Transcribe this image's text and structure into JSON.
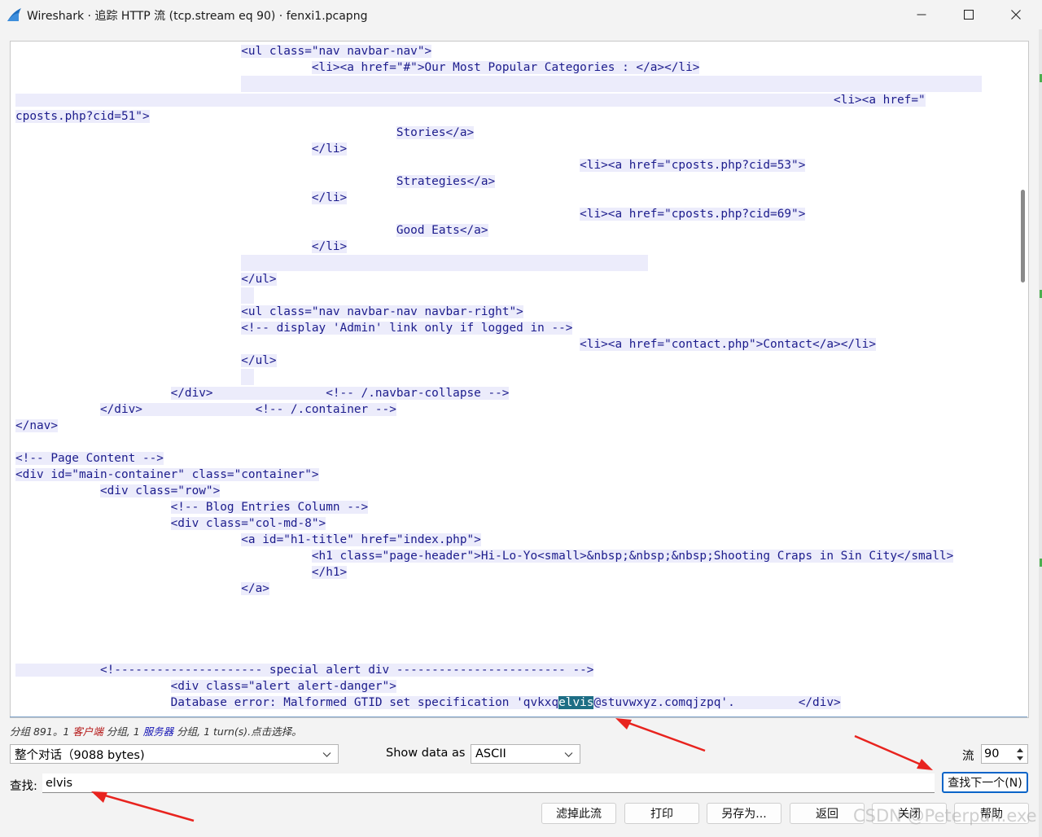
{
  "window": {
    "title": "Wireshark · 追踪 HTTP 流 (tcp.stream eq 90) · fenxi1.pcapng"
  },
  "stream": {
    "lines": [
      {
        "pre": "                                ",
        "text": "<ul class=\"nav navbar-nav\">",
        "kind": "t"
      },
      {
        "pre": "                                          ",
        "text": "<li><a href=\"#\">Our Most Popular Categories : </a></li>",
        "kind": "t"
      },
      {
        "pre": "                                ",
        "text": "",
        "kind": "fill"
      },
      {
        "pre": "",
        "text": "                                                                                                                    <li><a href=\"",
        "kind": "t"
      },
      {
        "pre": "",
        "text": "cposts.php?cid=51\">",
        "kind": "t"
      },
      {
        "pre": "                                                      ",
        "text": "Stories</a>",
        "kind": "t"
      },
      {
        "pre": "                                          ",
        "text": "</li>",
        "kind": "t"
      },
      {
        "pre": "                                                                                ",
        "text": "<li><a href=\"cposts.php?cid=53\">",
        "kind": "t"
      },
      {
        "pre": "                                                      ",
        "text": "Strategies</a>",
        "kind": "t"
      },
      {
        "pre": "                                          ",
        "text": "</li>",
        "kind": "t"
      },
      {
        "pre": "                                                                                ",
        "text": "<li><a href=\"cposts.php?cid=69\">",
        "kind": "t"
      },
      {
        "pre": "                                                      ",
        "text": "Good Eats</a>",
        "kind": "t"
      },
      {
        "pre": "                                          ",
        "text": "</li>",
        "kind": "t"
      },
      {
        "pre": "                                ",
        "text": "",
        "kind": "fillmid"
      },
      {
        "pre": "                                ",
        "text": "</ul>",
        "kind": "t"
      },
      {
        "pre": "                                ",
        "text": "",
        "kind": "fillsmall"
      },
      {
        "pre": "                                ",
        "text": "<ul class=\"nav navbar-nav navbar-right\">",
        "kind": "t"
      },
      {
        "pre": "                                ",
        "text": "<!-- display 'Admin' link only if logged in -->",
        "kind": "t"
      },
      {
        "pre": "                                                                                ",
        "text": "<li><a href=\"contact.php\">Contact</a></li>",
        "kind": "t"
      },
      {
        "pre": "                                ",
        "text": "</ul>",
        "kind": "t"
      },
      {
        "pre": "                                ",
        "text": "",
        "kind": "fillsmall"
      },
      {
        "pre": "                      ",
        "text": "</div>                <!-- /.navbar-collapse -->",
        "kind": "t"
      },
      {
        "pre": "            ",
        "text": "</div>                <!-- /.container -->",
        "kind": "t"
      },
      {
        "pre": "",
        "text": "</nav>",
        "kind": "t"
      },
      {
        "pre": "",
        "text": "",
        "kind": "empty"
      },
      {
        "pre": "",
        "text": "<!-- Page Content -->",
        "kind": "t"
      },
      {
        "pre": "",
        "text": "<div id=\"main-container\" class=\"container\">",
        "kind": "t"
      },
      {
        "pre": "            ",
        "text": "<div class=\"row\">",
        "kind": "t"
      },
      {
        "pre": "                      ",
        "text": "<!-- Blog Entries Column -->",
        "kind": "t"
      },
      {
        "pre": "                      ",
        "text": "<div class=\"col-md-8\">",
        "kind": "t"
      },
      {
        "pre": "                                ",
        "text": "<a id=\"h1-title\" href=\"index.php\">",
        "kind": "t"
      },
      {
        "pre": "                                          ",
        "text": "<h1 class=\"page-header\">Hi-Lo-Yo<small>&nbsp;&nbsp;&nbsp;Shooting Craps in Sin City</small>",
        "kind": "t"
      },
      {
        "pre": "                                          ",
        "text": "</h1>",
        "kind": "t"
      },
      {
        "pre": "                                ",
        "text": "</a>",
        "kind": "t"
      },
      {
        "pre": "",
        "text": "",
        "kind": "empty"
      },
      {
        "pre": "",
        "text": "",
        "kind": "empty"
      },
      {
        "pre": "",
        "text": "",
        "kind": "empty"
      },
      {
        "pre": "",
        "text": "",
        "kind": "empty"
      },
      {
        "pre": "",
        "text": "            <!--------------------- special alert div ------------------------ -->",
        "kind": "t"
      },
      {
        "pre": "                      ",
        "text": "<div class=\"alert alert-danger\">",
        "kind": "t"
      },
      {
        "pre": "                      ",
        "text": "Database error: Malformed GTID set specification 'qvkxq",
        "match": "elvis",
        "after": "@stuvwxyz.comqjzpq'.         </div>",
        "kind": "match"
      }
    ]
  },
  "status": {
    "prefix": "分组 891。1 ",
    "client_word": "客户端",
    "mid1": " 分组, 1 ",
    "server_word": "服务器",
    "suffix": " 分组, 1 turn(s).点击选择。"
  },
  "controls": {
    "conversation_select": "整个对话（9088 bytes)",
    "show_data_as_label": "Show data as",
    "show_data_as_value": "ASCII",
    "stream_label": "流",
    "stream_value": "90"
  },
  "find": {
    "label": "查找:",
    "value": "elvis",
    "next_button": "查找下一个(N)"
  },
  "buttons": {
    "filter": "滤掉此流",
    "print": "打印",
    "save_as": "另存为...",
    "back": "返回",
    "close": "关闭",
    "help": "帮助"
  },
  "watermark": "CSDN @Peterpan.exe",
  "colors": {
    "text_blue": "#1c1c8c",
    "row_highlight": "#ececfb",
    "match_highlight": "#1e6e85",
    "client_red": "#b41414",
    "server_blue": "#1414b4",
    "annotation_red": "#e8231e"
  }
}
